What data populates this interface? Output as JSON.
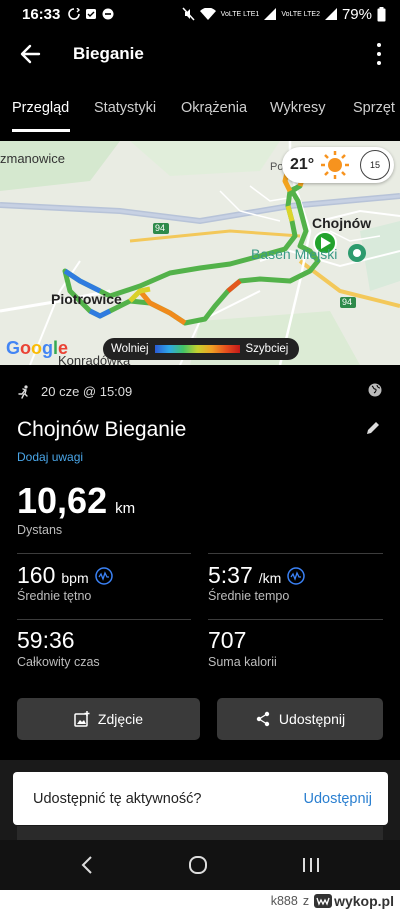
{
  "status_bar": {
    "time": "16:33",
    "network_label_1": "VoLTE LTE1",
    "network_label_2": "VoLTE LTE2",
    "battery": "79%"
  },
  "app_bar": {
    "title": "Bieganie"
  },
  "tabs": [
    "Przegląd",
    "Statystyki",
    "Okrążenia",
    "Wykresy",
    "Sprzęt"
  ],
  "map": {
    "places": [
      "zmanowice",
      "Chojnów",
      "Basen Miejski",
      "Piotrowice",
      "Konradówka",
      "Po"
    ],
    "road_numbers": [
      "94",
      "94",
      "94"
    ],
    "temperature": "21°",
    "wind": "15",
    "attribution": "Google",
    "legend_slow": "Wolniej",
    "legend_fast": "Szybciej"
  },
  "activity": {
    "date": "20 cze @ 15:09",
    "title": "Chojnów Bieganie",
    "add_notes": "Dodaj uwagi",
    "distance": "10,62",
    "distance_unit": "km",
    "distance_label": "Dystans",
    "avg_hr": "160",
    "avg_hr_unit": "bpm",
    "avg_hr_label": "Średnie tętno",
    "avg_pace": "5:37",
    "avg_pace_unit": "/km",
    "avg_pace_label": "Średnie tempo",
    "total_time": "59:36",
    "total_time_label": "Całkowity czas",
    "calories": "707",
    "calories_label": "Suma kalorii"
  },
  "buttons": {
    "photo": "Zdjęcie",
    "share": "Udostępnij"
  },
  "share_prompt": {
    "question": "Udostępnić tę aktywność?",
    "action": "Udostępnij"
  },
  "watermark": {
    "user": "k888",
    "sep": "z",
    "site": "wykop.pl"
  }
}
